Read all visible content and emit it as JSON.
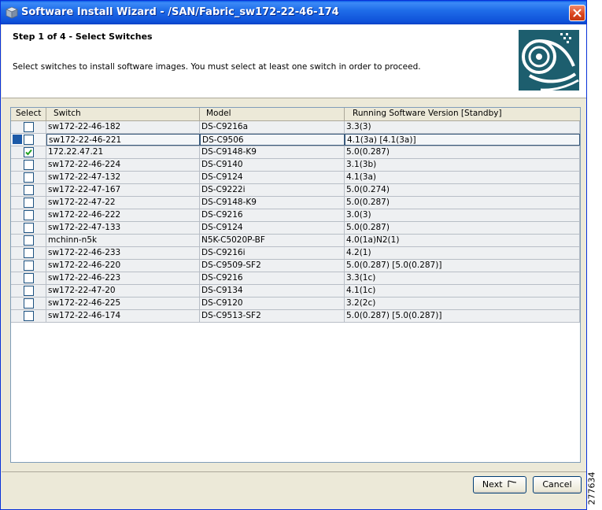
{
  "window": {
    "title": "Software Install Wizard - /SAN/Fabric_sw172-22-46-174"
  },
  "header": {
    "step_title": "Step 1 of 4 - Select Switches",
    "description": "Select switches to install software images. You must select at least one switch in order to proceed."
  },
  "table": {
    "columns": [
      "Select",
      "Switch",
      "Model",
      "Running Software Version [Standby]"
    ],
    "rows": [
      {
        "checked": false,
        "switch": "sw172-22-46-182",
        "model": "DS-C9216a",
        "version": "3.3(3)"
      },
      {
        "checked": false,
        "switch": "sw172-22-46-221",
        "model": "DS-C9506",
        "version": "4.1(3a) [4.1(3a)]"
      },
      {
        "checked": true,
        "switch": "172.22.47.21",
        "model": "DS-C9148-K9",
        "version": "5.0(0.287)"
      },
      {
        "checked": false,
        "switch": "sw172-22-46-224",
        "model": "DS-C9140",
        "version": "3.1(3b)"
      },
      {
        "checked": false,
        "switch": "sw172-22-47-132",
        "model": "DS-C9124",
        "version": "4.1(3a)"
      },
      {
        "checked": false,
        "switch": "sw172-22-47-167",
        "model": "DS-C9222i",
        "version": "5.0(0.274)"
      },
      {
        "checked": false,
        "switch": "sw172-22-47-22",
        "model": "DS-C9148-K9",
        "version": "5.0(0.287)"
      },
      {
        "checked": false,
        "switch": "sw172-22-46-222",
        "model": "DS-C9216",
        "version": "3.0(3)"
      },
      {
        "checked": false,
        "switch": "sw172-22-47-133",
        "model": "DS-C9124",
        "version": "5.0(0.287)"
      },
      {
        "checked": false,
        "switch": "mchinn-n5k",
        "model": "N5K-C5020P-BF",
        "version": "4.0(1a)N2(1)"
      },
      {
        "checked": false,
        "switch": "sw172-22-46-233",
        "model": "DS-C9216i",
        "version": "4.2(1)"
      },
      {
        "checked": false,
        "switch": "sw172-22-46-220",
        "model": "DS-C9509-SF2",
        "version": "5.0(0.287) [5.0(0.287)]"
      },
      {
        "checked": false,
        "switch": "sw172-22-46-223",
        "model": "DS-C9216",
        "version": "3.3(1c)"
      },
      {
        "checked": false,
        "switch": "sw172-22-47-20",
        "model": "DS-C9134",
        "version": "4.1(1c)"
      },
      {
        "checked": false,
        "switch": "sw172-22-46-225",
        "model": "DS-C9120",
        "version": "3.2(2c)"
      },
      {
        "checked": false,
        "switch": "sw172-22-46-174",
        "model": "DS-C9513-SF2",
        "version": "5.0(0.287) [5.0(0.287)]"
      }
    ]
  },
  "buttons": {
    "next_label": "Next",
    "cancel_label": "Cancel"
  },
  "figure_id": "277634",
  "icons": {
    "title": "wizard-box-icon",
    "close": "close-icon",
    "logo": "cisco-wizard-logo",
    "next": "next-arrow-icon",
    "check": "checkmark-icon"
  },
  "colors": {
    "titlebar": "#0e50d8",
    "close": "#d9431c",
    "logo": "#1d5e6e",
    "check": "#21a121"
  }
}
